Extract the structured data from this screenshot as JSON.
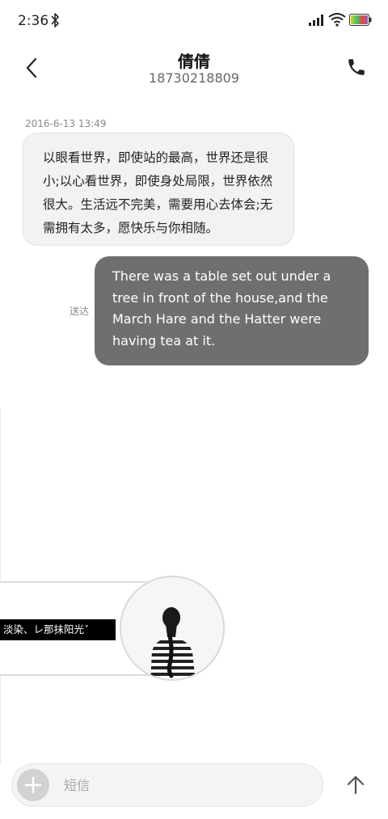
{
  "status_bar": {
    "time": "2:36",
    "icons": [
      "bluetooth-icon",
      "signal-icon",
      "wifi-icon",
      "battery-icon"
    ]
  },
  "header": {
    "contact_name": "倩倩",
    "contact_number": "18730218809",
    "back_icon": "back-arrow-icon",
    "call_icon": "phone-icon"
  },
  "conversation": {
    "timestamp": "2016-6-13 13:49",
    "incoming_message": "以眼看世界，即使站的最高，世界还是很小;以心看世界，即使身处局限，世界依然很大。生活远不完美，需要用心去体会;无需拥有太多，愿快乐与你相随。",
    "outgoing_message": "There was a table set out under a tree in front of the house,and the March Hare and the Hatter were having tea at it.",
    "outgoing_status": "送达"
  },
  "wallpaper": {
    "banner_text": "淡染、レ那抹阳光ˇ"
  },
  "composer": {
    "placeholder": "短信",
    "value": "",
    "add_icon": "plus-icon",
    "send_icon": "arrow-up-icon"
  },
  "colors": {
    "incoming_bubble": "#f2f2f2",
    "outgoing_bubble": "#6f6f6f",
    "muted_text": "#8a8a8a"
  }
}
